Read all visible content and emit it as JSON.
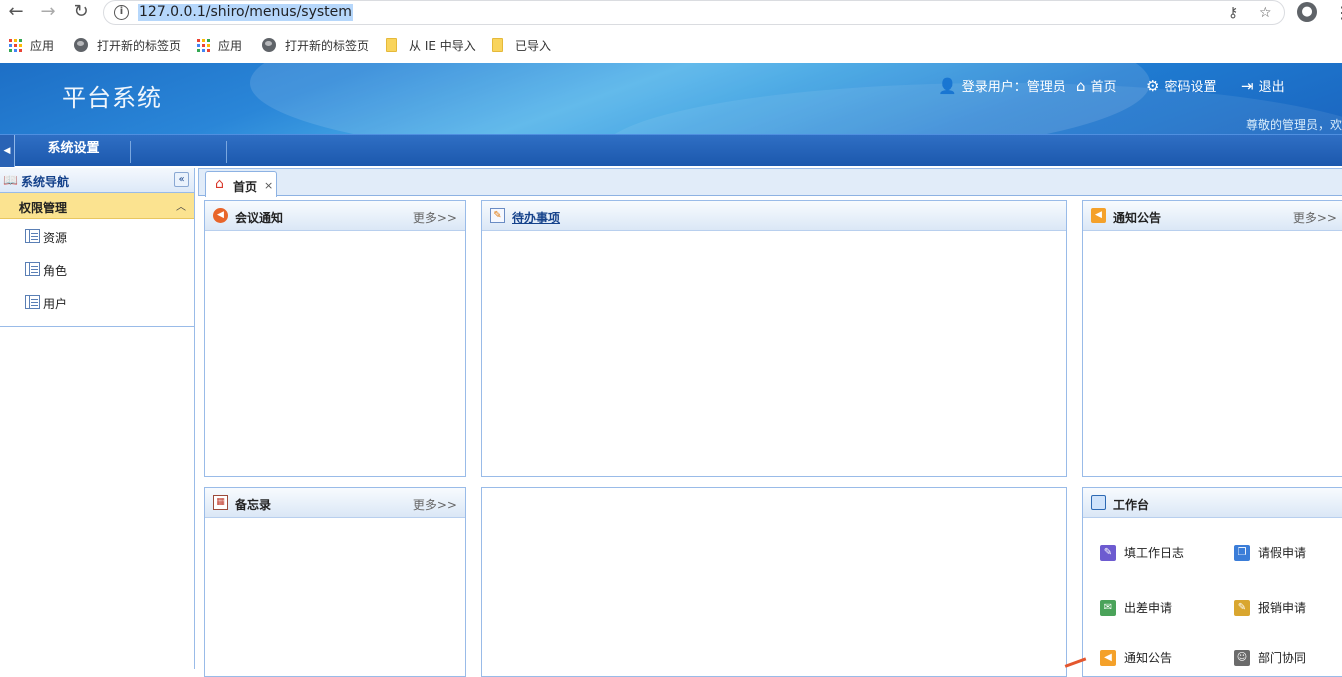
{
  "browser": {
    "url": "127.0.0.1/shiro/menus/system",
    "bookmarks": [
      {
        "label": "应用",
        "icon": "apps-grid-icon"
      },
      {
        "label": "打开新的标签页",
        "icon": "globe-icon"
      },
      {
        "label": "应用",
        "icon": "apps-grid-icon"
      },
      {
        "label": "打开新的标签页",
        "icon": "globe-icon"
      },
      {
        "label": "从 IE 中导入",
        "icon": "folder-icon"
      },
      {
        "label": "已导入",
        "icon": "folder-icon"
      }
    ]
  },
  "header": {
    "title": "平台系统",
    "login_user": "登录用户：管理员",
    "home": "首页",
    "password": "密码设置",
    "logout": "退出",
    "welcome": "尊敬的管理员，欢"
  },
  "menubar": {
    "items": [
      "系统设置"
    ]
  },
  "sidebar": {
    "title": "系统导航",
    "collapse": "«",
    "group": "权限管理",
    "items": [
      {
        "label": "资源"
      },
      {
        "label": "角色"
      },
      {
        "label": "用户"
      }
    ]
  },
  "tabs": [
    {
      "label": "首页",
      "close": "×"
    }
  ],
  "panels": {
    "meeting": {
      "title": "会议通知",
      "more": "更多>>"
    },
    "todo": {
      "title": "待办事项"
    },
    "notice": {
      "title": "通知公告",
      "more": "更多>>"
    },
    "memo": {
      "title": "备忘录",
      "more": "更多>>"
    },
    "workbench": {
      "title": "工作台",
      "items": [
        {
          "label": "填工作日志",
          "icon": "edit-log-icon",
          "color": "#6d5bd0"
        },
        {
          "label": "请假申请",
          "icon": "copy-document-icon",
          "color": "#3b7dd8"
        },
        {
          "label": "出差申请",
          "icon": "travel-request-icon",
          "color": "#4aa35a"
        },
        {
          "label": "报销申请",
          "icon": "reimburse-icon",
          "color": "#d9a62f"
        },
        {
          "label": "通知公告",
          "icon": "speaker-icon",
          "color": "#f4a12a"
        },
        {
          "label": "部门协同",
          "icon": "people-icon",
          "color": "#6b6b6b"
        }
      ]
    }
  },
  "colors": {
    "header_blue": "#1f7bd1",
    "menubar_blue": "#1c58ad",
    "group_yellow": "#fbe390",
    "border_blue": "#99bbe8"
  }
}
